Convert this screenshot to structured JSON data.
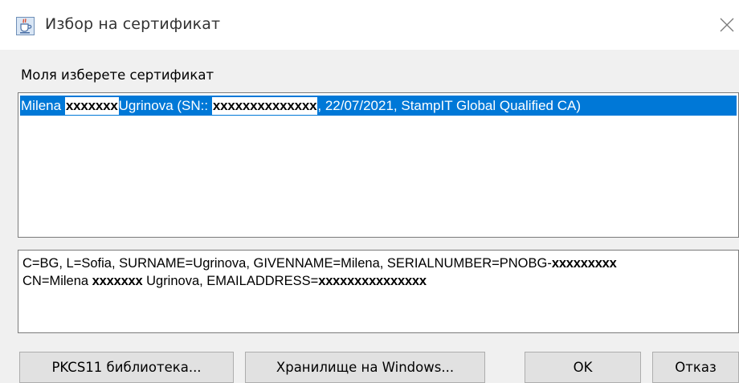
{
  "window": {
    "title": "Избор на сертификат",
    "icon": "java-cup-icon"
  },
  "dialog": {
    "prompt": "Моля изберете сертификат",
    "certificates": [
      {
        "part1": "Milena ",
        "redacted_name": "xxxxxxx",
        "part2": "Ugrinova (SN:: ",
        "redacted_sn": "xxxxxxxxxxxxxx",
        "part3": ", 22/07/2021, StampIT Global Qualified CA)",
        "selected": true
      }
    ],
    "details": {
      "line1_text": "C=BG, L=Sofia, SURNAME=Ugrinova, GIVENNAME=Milena, SERIALNUMBER=PNOBG-",
      "line1_redacted": "xxxxxxxxx",
      "line2_prefix": "CN=Milena ",
      "line2_redacted_name": "xxxxxxx",
      "line2_middle": " Ugrinova, EMAILADDRESS=",
      "line2_redacted_email": "xxxxxxxxxxxxxxx"
    }
  },
  "buttons": {
    "pkcs11": "PKCS11 библиотека...",
    "windows_store": "Хранилище на Windows...",
    "ok": "OK",
    "cancel": "Отказ"
  },
  "colors": {
    "selection": "#0078d7",
    "dialog_bg": "#f0f0f0",
    "button_bg": "#e1e1e1",
    "border": "#7a7a7a"
  }
}
